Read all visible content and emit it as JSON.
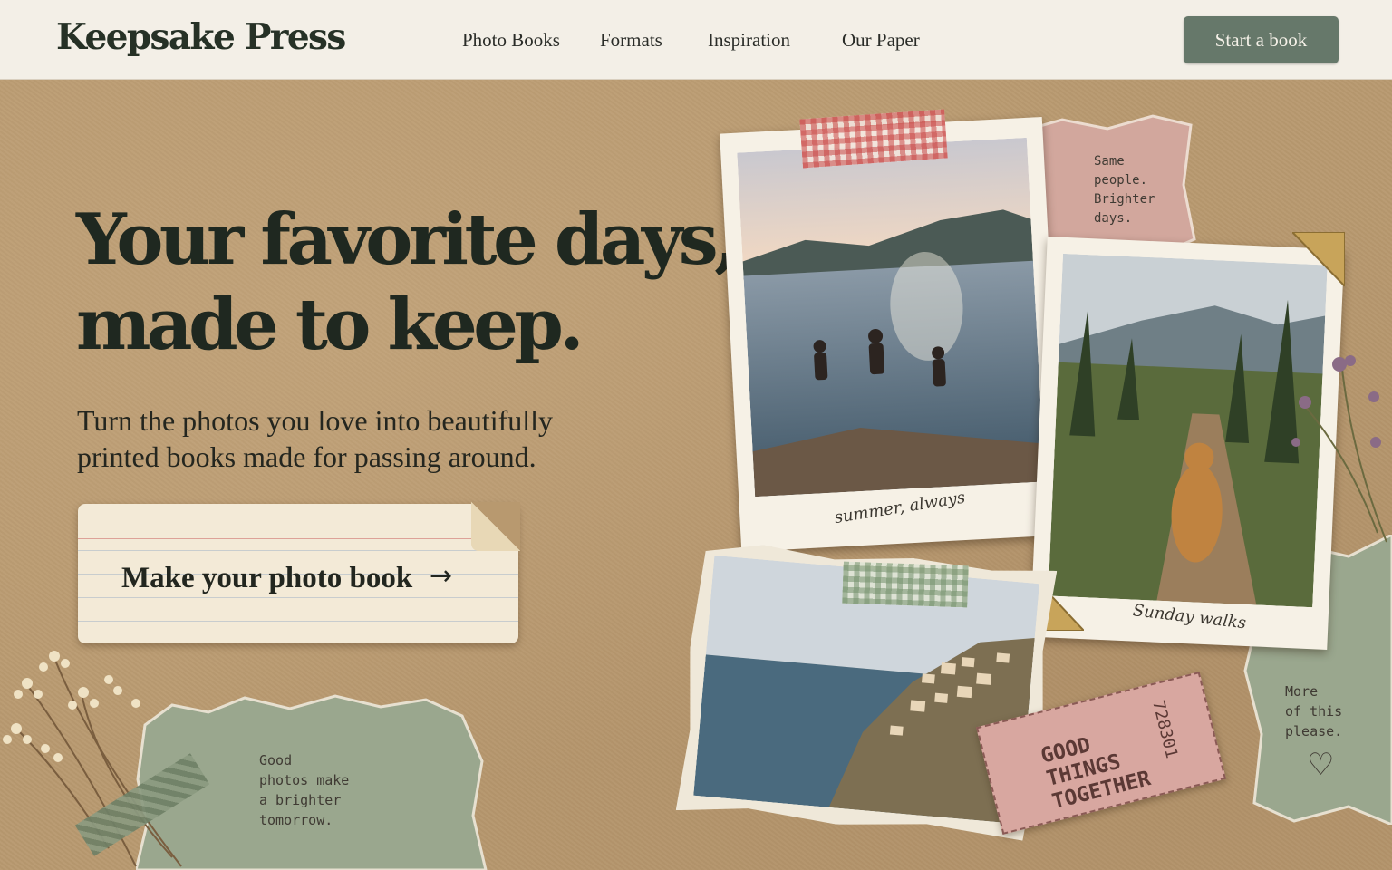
{
  "header": {
    "brand": "Keepsake Press",
    "nav": [
      "Photo Books",
      "Formats",
      "Inspiration",
      "Our Paper"
    ],
    "cta": "Start a book"
  },
  "hero": {
    "headline_lines": [
      "Your favorite days,",
      "made to keep."
    ],
    "sub_lines": [
      "Turn the photos you love into beautifully",
      "printed books made for passing around."
    ],
    "primary_button": "Make your photo book",
    "arrow_icon": "→"
  },
  "collage": {
    "polaroid_lake_caption": "summer, always",
    "polaroid_trail_caption": "Sunday walks",
    "note_top_lines": [
      "Same",
      "people.",
      "Brighter",
      "days."
    ],
    "note_right_lines": [
      "More",
      "of this",
      "please."
    ],
    "note_bottom_lines": [
      "Good",
      "photos make",
      "a brighter",
      "tomorrow."
    ],
    "ticket_lines": [
      "GOOD",
      "THINGS",
      "TOGETHER"
    ],
    "ticket_number": "728301",
    "heart_icon": "♡"
  },
  "colors": {
    "kraft": "#b8996f",
    "sage": "#66786a",
    "ink": "#1f2820",
    "paper": "#f3ead7",
    "rose": "#d8a7a0"
  }
}
